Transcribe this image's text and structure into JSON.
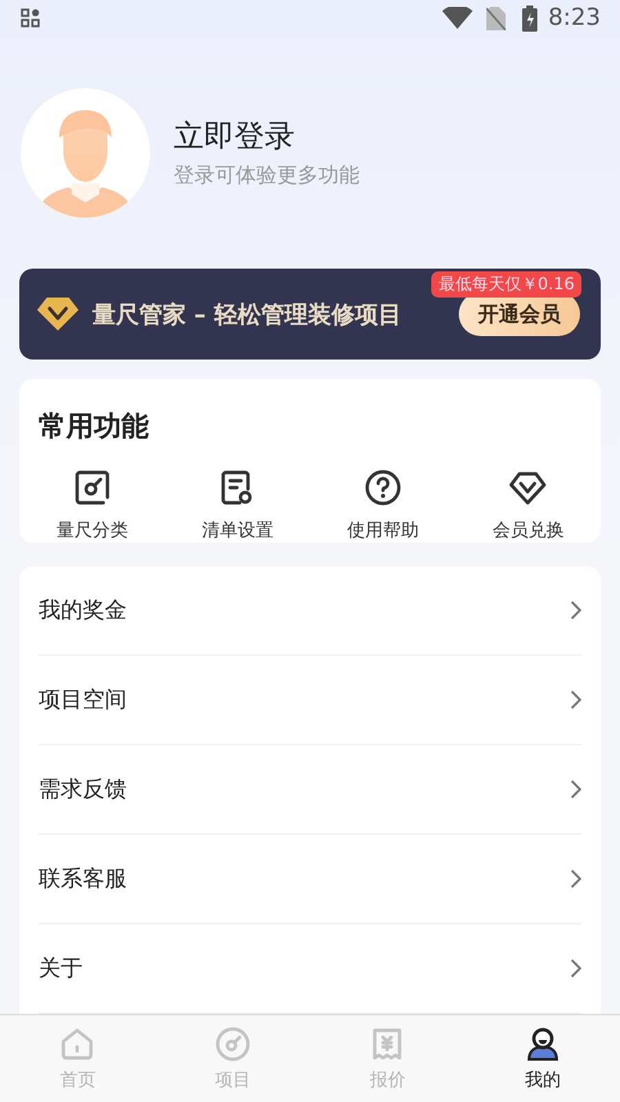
{
  "status_bar": {
    "time": "8:23"
  },
  "profile": {
    "title": "立即登录",
    "subtitle": "登录可体验更多功能"
  },
  "vip_banner": {
    "text": "量尺管家 – 轻松管理装修项目",
    "badge": "最低每天仅￥0.16",
    "button": "开通会员"
  },
  "common_functions": {
    "title": "常用功能",
    "items": [
      {
        "label": "量尺分类",
        "kind": "measure"
      },
      {
        "label": "清单设置",
        "kind": "list"
      },
      {
        "label": "使用帮助",
        "kind": "help"
      },
      {
        "label": "会员兑换",
        "kind": "vip"
      }
    ]
  },
  "menu": [
    {
      "label": "我的奖金"
    },
    {
      "label": "项目空间"
    },
    {
      "label": "需求反馈"
    },
    {
      "label": "联系客服"
    },
    {
      "label": "关于"
    }
  ],
  "tab_bar": [
    {
      "label": "首页",
      "kind": "home",
      "selected": false
    },
    {
      "label": "项目",
      "kind": "project",
      "selected": false
    },
    {
      "label": "报价",
      "kind": "quote",
      "selected": false
    },
    {
      "label": "我的",
      "kind": "mine",
      "selected": true
    }
  ]
}
